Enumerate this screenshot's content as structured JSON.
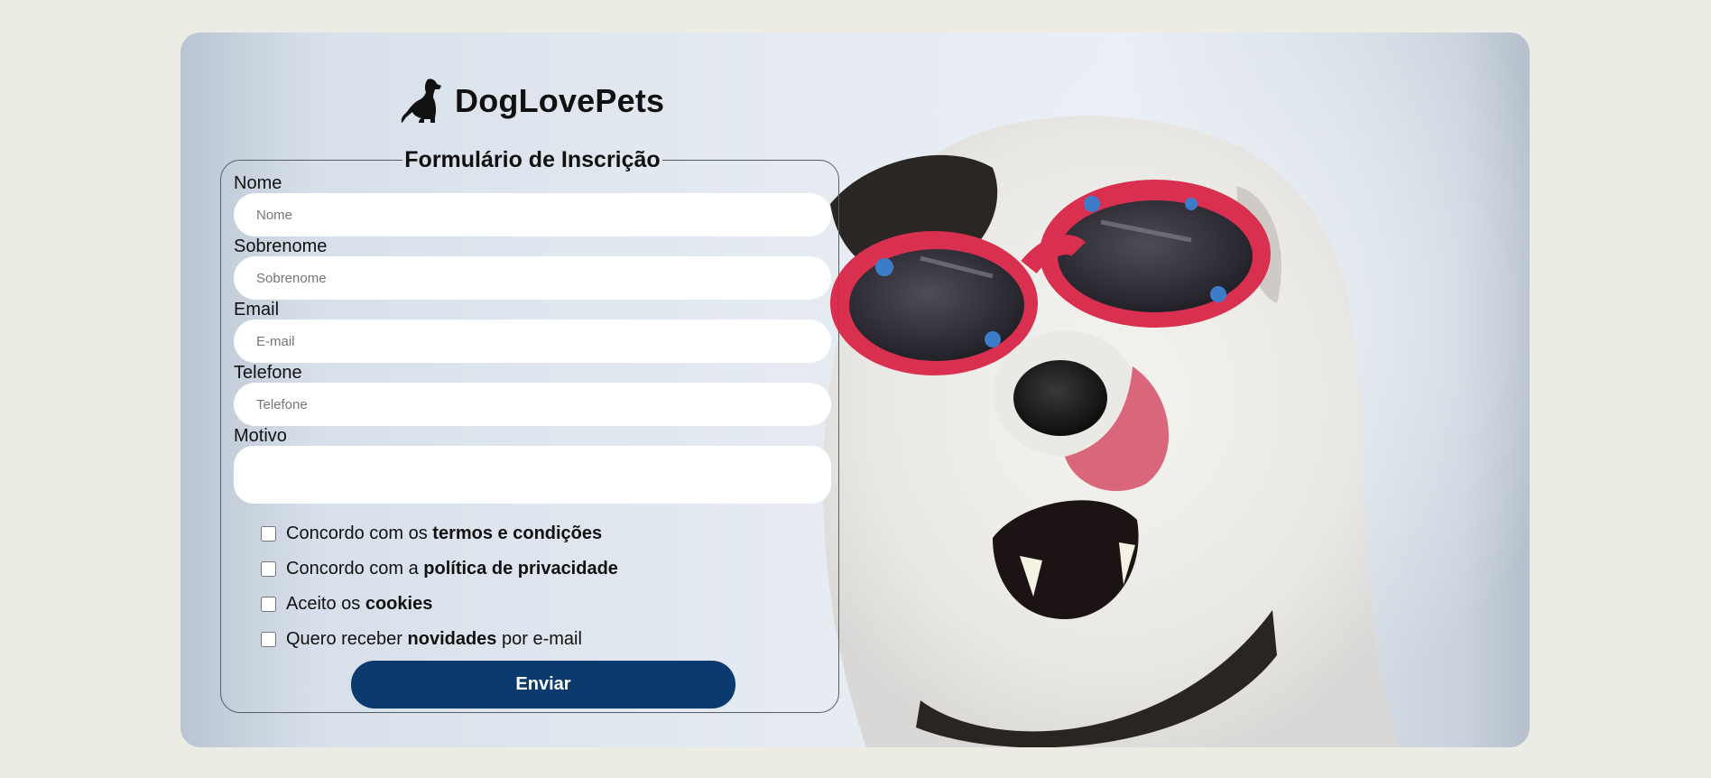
{
  "brand": {
    "name": "DogLovePets",
    "logo_icon": "dog-sitting-icon"
  },
  "form": {
    "legend": "Formulário de Inscrição",
    "fields": [
      {
        "label": "Nome",
        "placeholder": "Nome",
        "value": ""
      },
      {
        "label": "Sobrenome",
        "placeholder": "Sobrenome",
        "value": ""
      },
      {
        "label": "Email",
        "placeholder": "E-mail",
        "value": ""
      },
      {
        "label": "Telefone",
        "placeholder": "Telefone",
        "value": ""
      }
    ],
    "motivo": {
      "label": "Motivo",
      "value": ""
    },
    "checkboxes": [
      {
        "prefix": "Concordo com os ",
        "bold": "termos e condições",
        "suffix": "",
        "checked": false
      },
      {
        "prefix": "Concordo com a ",
        "bold": "política de privacidade",
        "suffix": "",
        "checked": false
      },
      {
        "prefix": "Aceito os ",
        "bold": "cookies",
        "suffix": "",
        "checked": false
      },
      {
        "prefix": "Quero receber ",
        "bold": "novidades",
        "suffix": " por e-mail",
        "checked": false
      }
    ],
    "submit_label": "Enviar"
  },
  "colors": {
    "page_background": "#ecebe4",
    "submit_button": "#0b3a6e",
    "glasses_frame": "#d8304e"
  }
}
